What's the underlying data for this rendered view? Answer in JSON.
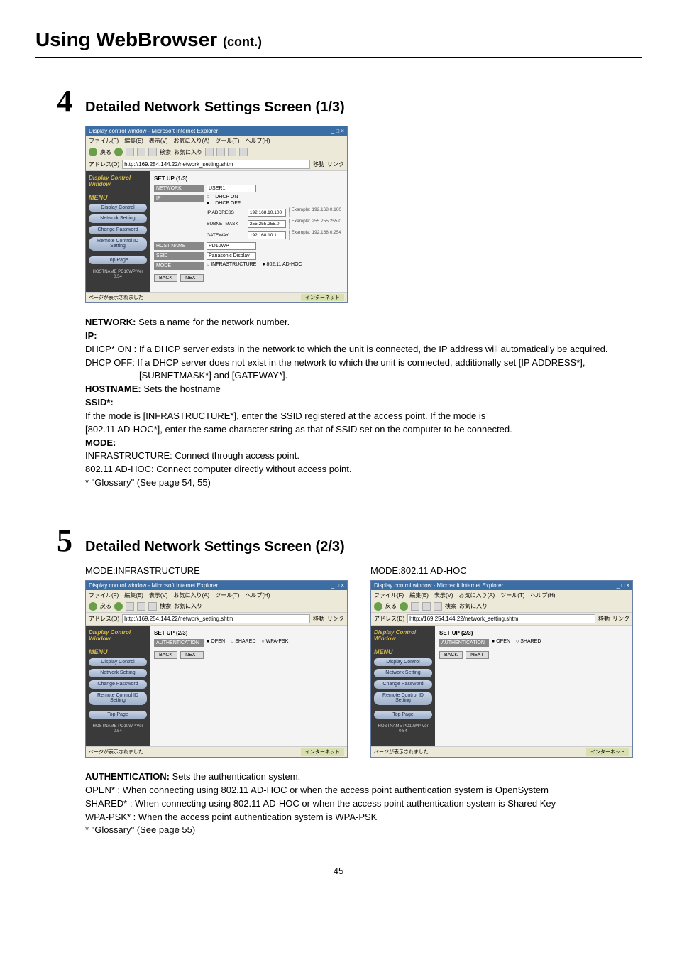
{
  "page": {
    "title_main": "Using WebBrowser",
    "title_cont": "(cont.)",
    "page_number": "45"
  },
  "step4": {
    "number": "4",
    "heading": "Detailed Network Settings Screen (1/3)",
    "shot": {
      "win_title": "Display control window - Microsoft Internet Explorer",
      "menubar": "ファイル(F)　編集(E)　表示(V)　お気に入り(A)　ツール(T)　ヘルプ(H)",
      "toolbar_back": "戻る",
      "toolbar_search": "検索",
      "toolbar_fav": "お気に入り",
      "addr_label": "アドレス(D)",
      "addr_url": "http://169.254.144.22/network_setting.shtm",
      "go": "移動",
      "links": "リンク",
      "left_header": "Display Control Window",
      "menu_lbl": "MENU",
      "side_display": "Display Control",
      "side_net": "Network Setting",
      "side_pass": "Change Password",
      "side_remote": "Remote Control ID Setting",
      "side_top": "Top Page",
      "host": "HOSTNAME PD10WP Ver 0.54",
      "setup": "SET UP (1/3)",
      "row_network": "NETWORK",
      "row_network_val": "USER1",
      "row_ip": "IP",
      "dhcp_on": "DHCP ON",
      "dhcp_off": "DHCP OFF",
      "ip_lbl": "IP ADDRESS",
      "ip_val": "192.168.10.100",
      "ip_ex": "[ Example: 192.168.0.100 ]",
      "sn_lbl": "SUBNETMASK",
      "sn_val": "255.255.255.0",
      "sn_ex": "[ Example: 255.255.255.0 ]",
      "gw_lbl": "GATEWAY",
      "gw_val": "192.168.10.1",
      "gw_ex": "[ Example: 192.168.0.254 ]",
      "hostname_lbl": "HOST NAME",
      "hostname_val": "PD10WP",
      "ssid_lbl": "SSID",
      "ssid_val": "Panasonic Display",
      "mode_lbl": "MODE",
      "mode_infra": "INFRASTRUCTURE",
      "mode_adhoc": "802.11 AD-HOC",
      "btn_back": "BACK",
      "btn_next": "NEXT",
      "status_l": "ページが表示されました",
      "status_r": "インターネット"
    },
    "desc": {
      "network_t": "NETWORK:",
      "network_b": "  Sets a name for the network number.",
      "ip_t": "IP:",
      "dhcp_on": "DHCP* ON : If a DHCP server exists in the network to which the unit is connected, the IP address will automatically be acquired.",
      "dhcp_off": "DHCP OFF: If a DHCP server does not exist in the network to which the unit is connected, additionally set [IP ADDRESS*], [SUBNETMASK*] and [GATEWAY*].",
      "hostname_t": "HOSTNAME:",
      "hostname_b": " Sets the hostname",
      "ssid_t": "SSID*:",
      "ssid_b1": "If the mode is [INFRASTRUCTURE*], enter the SSID registered at the access point. If the mode is",
      "ssid_b2": "[802.11 AD-HOC*], enter the same character string as that of SSID set on the computer to be connected.",
      "mode_t": "MODE:",
      "mode_infra": "INFRASTRUCTURE: Connect through access point.",
      "mode_adhoc": "802.11 AD-HOC: Connect computer directly without access point.",
      "gloss": "* \"Glossary\" (See page 54, 55)"
    }
  },
  "step5": {
    "number": "5",
    "heading": "Detailed Network Settings Screen (2/3)",
    "label_infra": "MODE:INFRASTRUCTURE",
    "label_adhoc": "MODE:802.11 AD-HOC",
    "shot": {
      "setup": "SET UP (2/3)",
      "auth_lbl": "AUTHENTICATION",
      "open": "OPEN",
      "shared": "SHARED",
      "wpa": "WPA-PSK"
    },
    "desc": {
      "auth_t": "AUTHENTICATION:",
      "auth_b": " Sets the authentication system.",
      "l_open": "OPEN* : When connecting using 802.11 AD-HOC or when the access point authentication system is OpenSystem",
      "l_shared": "SHARED* : When connecting using 802.11 AD-HOC or when the access point authentication system is Shared Key",
      "l_wpa": "WPA-PSK* : When the access point authentication system is WPA-PSK",
      "gloss": "* \"Glossary\" (See page 55)"
    }
  }
}
